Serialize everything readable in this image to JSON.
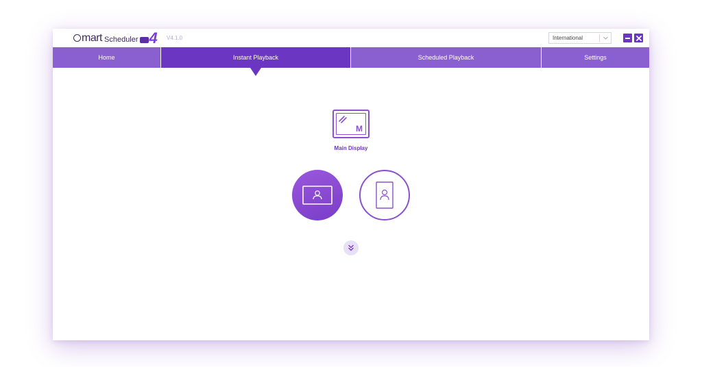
{
  "app": {
    "logo_text_smart": "mart",
    "logo_text_scheduler": "Scheduler",
    "logo_version_mark": "4",
    "version": "V4.1.0"
  },
  "language": {
    "selected": "International"
  },
  "window_controls": {
    "minimize_icon": "minimize-icon",
    "close_icon": "close-icon"
  },
  "nav": {
    "tabs": [
      {
        "label": "Home",
        "active": false
      },
      {
        "label": "Instant Playback",
        "active": true
      },
      {
        "label": "Scheduled Playback",
        "active": false
      },
      {
        "label": "Settings",
        "active": false
      }
    ]
  },
  "display": {
    "label": "Main Display",
    "badge": "M"
  },
  "orientation": {
    "landscape_icon": "landscape-user-icon",
    "portrait_icon": "portrait-user-icon"
  },
  "expand": {
    "icon": "double-chevron-down-icon"
  },
  "colors": {
    "accent": "#6a36c2",
    "nav": "#8a60d0",
    "light": "#e8e0f4"
  }
}
